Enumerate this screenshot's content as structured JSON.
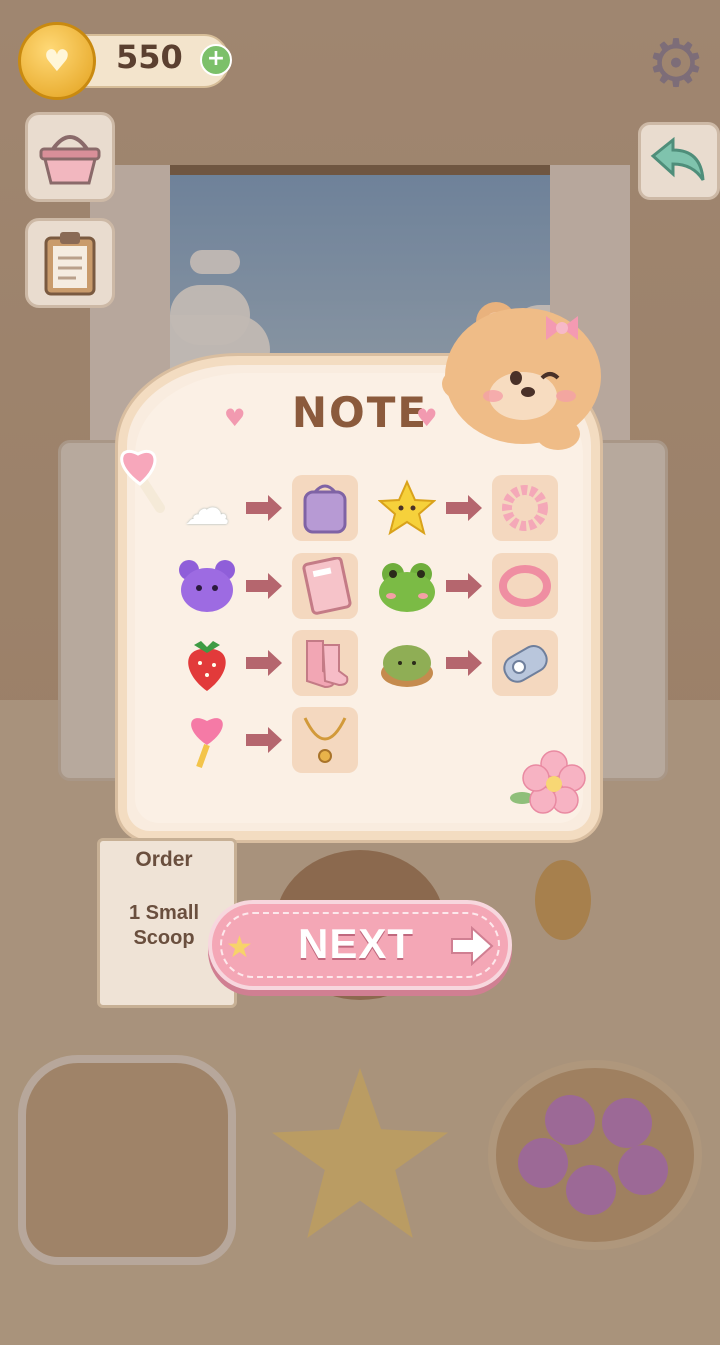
{
  "hud": {
    "coins": "550",
    "coin_icon": "heart-coin-icon",
    "add_icon": "plus-icon",
    "settings_icon": "gear-icon"
  },
  "side_buttons": [
    {
      "icon": "basket-icon"
    },
    {
      "icon": "clipboard-icon"
    }
  ],
  "back_button": {
    "icon": "back-arrow-icon"
  },
  "note": {
    "title": "NOTE",
    "recipes": [
      {
        "ingredient": "cloud-charm",
        "glyph": "☁",
        "result": "purple-bag-icon"
      },
      {
        "ingredient": "star-charm",
        "glyph": "★",
        "result": "pink-scrunchie-icon"
      },
      {
        "ingredient": "purple-bear-charm",
        "glyph": "ʕ•ᴥ•ʔ",
        "result": "notebook-icon"
      },
      {
        "ingredient": "frog-charm",
        "glyph": "🐸",
        "result": "pink-bracelet-icon"
      },
      {
        "ingredient": "strawberry-charm",
        "glyph": "🍓",
        "result": "pink-socks-icon"
      },
      {
        "ingredient": "matcha-tart-charm",
        "glyph": "🍵",
        "result": "correction-tape-icon"
      },
      {
        "ingredient": "heart-wand-charm",
        "glyph": "💗",
        "result": "gold-necklace-icon"
      }
    ]
  },
  "order": {
    "title": "Order",
    "line1": "1 Small",
    "line2": "Scoop"
  },
  "next_button": {
    "label": "NEXT"
  },
  "colors": {
    "note_bg": "#fbf0e5",
    "title": "#8b5a3c",
    "next_btn": "#f4a7b6",
    "arrow": "#b5666e"
  }
}
